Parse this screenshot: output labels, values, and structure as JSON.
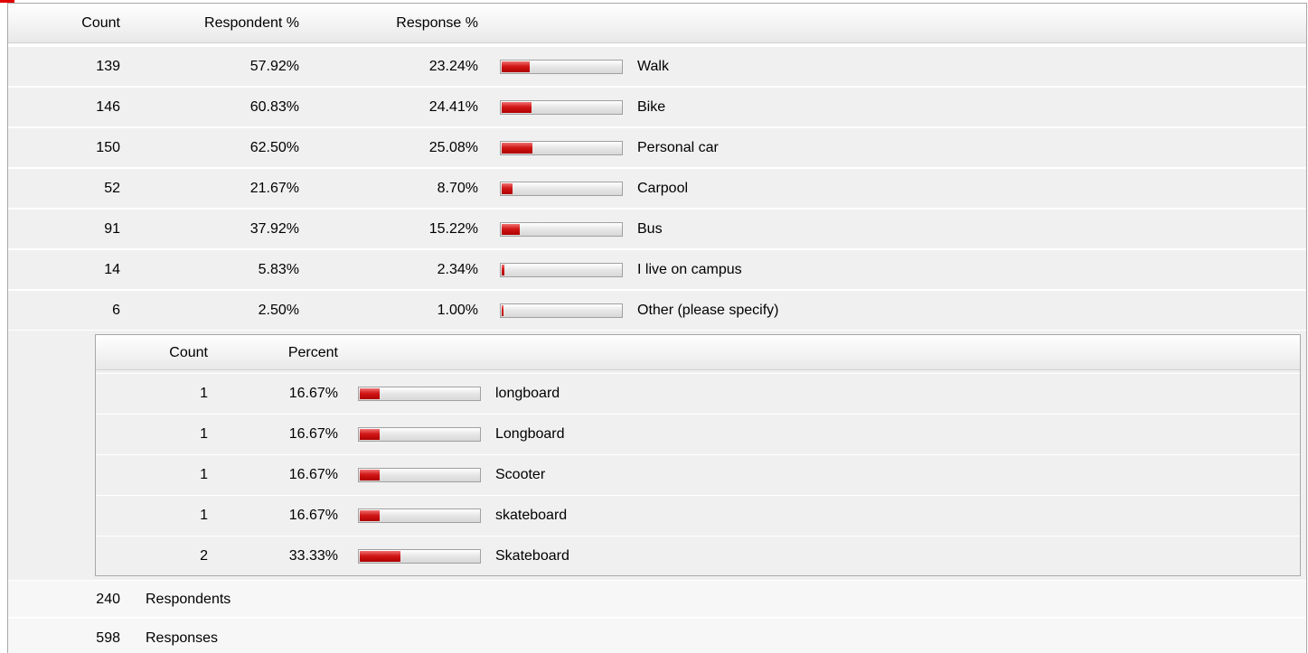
{
  "main_table": {
    "headers": {
      "count": "Count",
      "respondent_pct": "Respondent %",
      "response_pct": "Response %"
    },
    "rows": [
      {
        "count": "139",
        "respondent_pct": "57.92%",
        "response_pct": "23.24%",
        "fill": 0.2324,
        "label": "Walk"
      },
      {
        "count": "146",
        "respondent_pct": "60.83%",
        "response_pct": "24.41%",
        "fill": 0.2441,
        "label": "Bike"
      },
      {
        "count": "150",
        "respondent_pct": "62.50%",
        "response_pct": "25.08%",
        "fill": 0.2508,
        "label": "Personal car"
      },
      {
        "count": "52",
        "respondent_pct": "21.67%",
        "response_pct": "8.70%",
        "fill": 0.087,
        "label": "Carpool"
      },
      {
        "count": "91",
        "respondent_pct": "37.92%",
        "response_pct": "15.22%",
        "fill": 0.1522,
        "label": "Bus"
      },
      {
        "count": "14",
        "respondent_pct": "5.83%",
        "response_pct": "2.34%",
        "fill": 0.0234,
        "label": "I live on campus"
      },
      {
        "count": "6",
        "respondent_pct": "2.50%",
        "response_pct": "1.00%",
        "fill": 0.01,
        "label": "Other (please specify)"
      }
    ]
  },
  "other_table": {
    "headers": {
      "count": "Count",
      "percent": "Percent"
    },
    "rows": [
      {
        "count": "1",
        "percent": "16.67%",
        "fill": 0.1667,
        "label": "longboard"
      },
      {
        "count": "1",
        "percent": "16.67%",
        "fill": 0.1667,
        "label": "Longboard"
      },
      {
        "count": "1",
        "percent": "16.67%",
        "fill": 0.1667,
        "label": "Scooter"
      },
      {
        "count": "1",
        "percent": "16.67%",
        "fill": 0.1667,
        "label": "skateboard"
      },
      {
        "count": "2",
        "percent": "33.33%",
        "fill": 0.3333,
        "label": "Skateboard"
      }
    ]
  },
  "footer": {
    "respondents_count": "240",
    "respondents_label": "Respondents",
    "responses_count": "598",
    "responses_label": "Responses"
  },
  "colors": {
    "bar_fill": "#d21818",
    "bar_track": "#e6e6e6",
    "accent": "#e00000"
  }
}
